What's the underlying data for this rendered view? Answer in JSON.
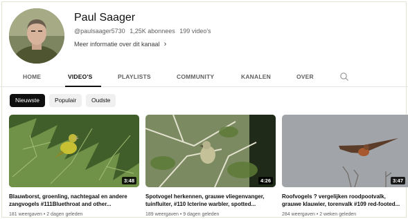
{
  "channel": {
    "name": "Paul Saager",
    "handle": "@paulsaager5730",
    "subscribers": "1,25K abonnees",
    "videos_count": "199 video's",
    "more_info": "Meer informatie over dit kanaal"
  },
  "tabs": [
    {
      "label": "HOME",
      "active": false
    },
    {
      "label": "VIDEO'S",
      "active": true
    },
    {
      "label": "PLAYLISTS",
      "active": false
    },
    {
      "label": "COMMUNITY",
      "active": false
    },
    {
      "label": "KANALEN",
      "active": false
    },
    {
      "label": "OVER",
      "active": false
    }
  ],
  "chips": [
    {
      "label": "Nieuwste",
      "active": true
    },
    {
      "label": "Populair",
      "active": false
    },
    {
      "label": "Oudste",
      "active": false
    }
  ],
  "videos": [
    {
      "duration": "3:48",
      "title": "Blauwborst, groenling, nachtegaal en andere zangvogels #111Bluethroat and other...",
      "meta": "181 weergaven • 2 dagen geleden"
    },
    {
      "duration": "4:26",
      "title": "Spotvogel herkennen, grauwe vliegenvanger, tuinfluiter, #110 Icterine warbler, spotted...",
      "meta": "189 weergaven • 9 dagen geleden"
    },
    {
      "duration": "3:47",
      "title": "Roofvogels ? vergelijken roodpootvalk, grauwe klauwier, torenvalk #109 red-footed...",
      "meta": "284 weergaven • 2 weken geleden"
    }
  ],
  "icons": {
    "more_info": "chevron-right-icon",
    "search": "search-icon"
  }
}
